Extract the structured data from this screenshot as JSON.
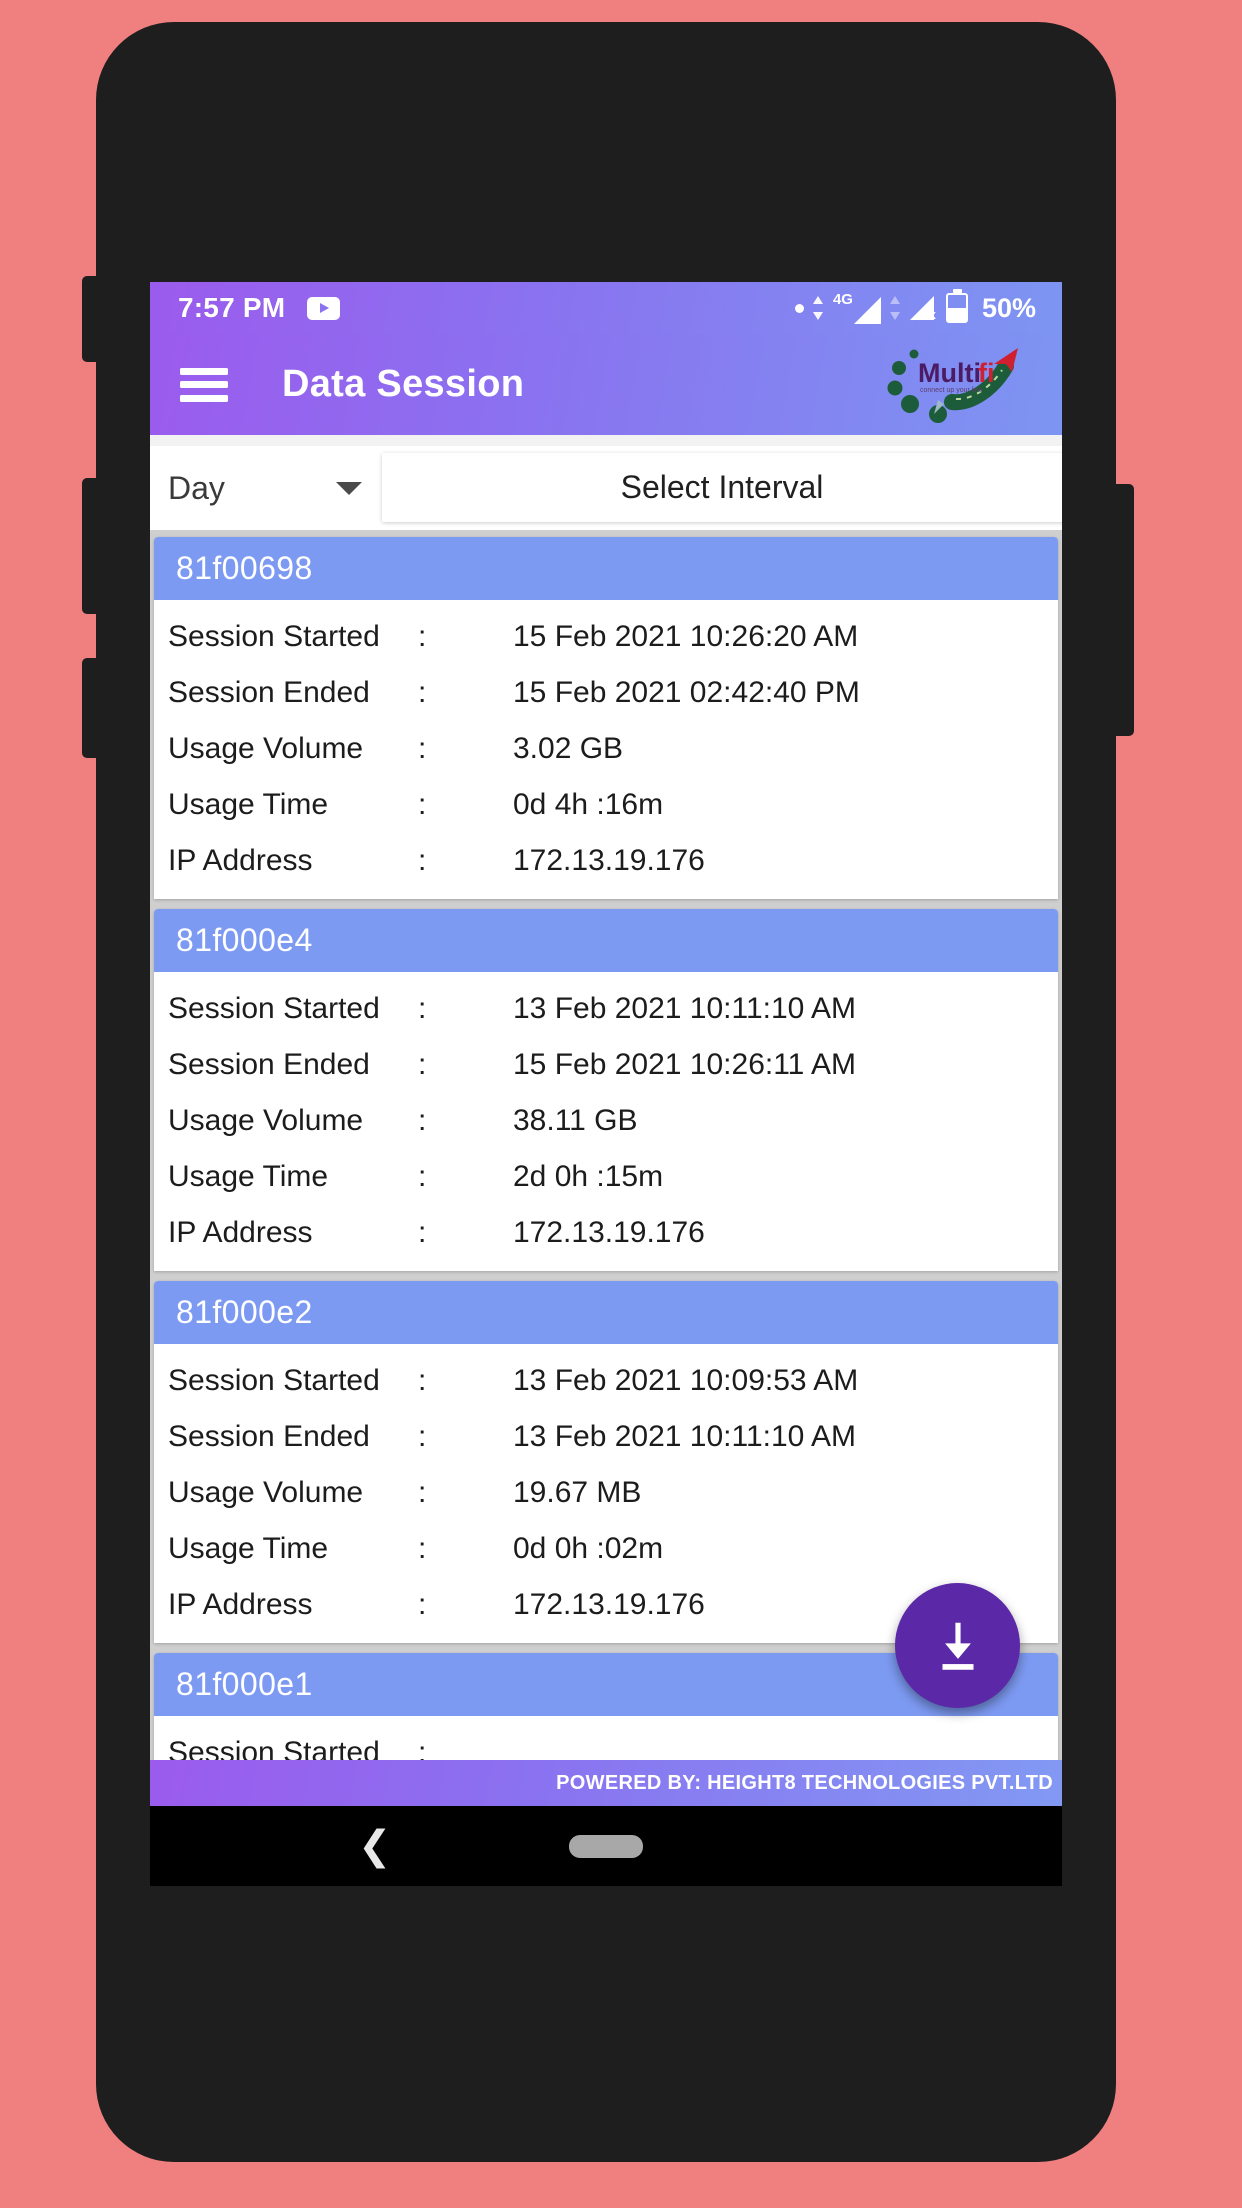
{
  "statusbar": {
    "time": "7:57 PM",
    "app_icon": "youtube-icon",
    "network_label": "4G",
    "battery_percent": "50%"
  },
  "appbar": {
    "menu_icon": "hamburger-menu-icon",
    "title": "Data Session",
    "logo_primary": "Multi",
    "logo_accent": "fi",
    "logo_tagline": "connect up your line"
  },
  "filter": {
    "period_value": "Day",
    "period_caret": "chevron-down-icon",
    "interval_button": "Select Interval"
  },
  "labels": {
    "session_started": "Session Started",
    "session_ended": "Session Ended",
    "usage_volume": "Usage Volume",
    "usage_time": "Usage Time",
    "ip_address": "IP Address",
    "separator": ":"
  },
  "sessions": [
    {
      "id": "81f00698",
      "session_started": "15 Feb 2021 10:26:20 AM",
      "session_ended": "15 Feb 2021 02:42:40 PM",
      "usage_volume": "3.02 GB",
      "usage_time": "0d 4h :16m",
      "ip_address": "172.13.19.176"
    },
    {
      "id": "81f000e4",
      "session_started": "13 Feb 2021 10:11:10 AM",
      "session_ended": "15 Feb 2021 10:26:11 AM",
      "usage_volume": "38.11 GB",
      "usage_time": "2d 0h :15m",
      "ip_address": "172.13.19.176"
    },
    {
      "id": "81f000e2",
      "session_started": "13 Feb 2021 10:09:53 AM",
      "session_ended": "13 Feb 2021 10:11:10 AM",
      "usage_volume": "19.67 MB",
      "usage_time": "0d 0h :02m",
      "ip_address": "172.13.19.176"
    },
    {
      "id": "81f000e1",
      "session_started": "",
      "session_ended": "",
      "usage_volume": "",
      "usage_time": "",
      "ip_address": ""
    }
  ],
  "fab": {
    "icon": "download-icon"
  },
  "footer": {
    "text": "POWERED BY: HEIGHT8 TECHNOLOGIES PVT.LTD"
  },
  "navbar": {
    "back_icon": "back-chevron-icon",
    "home_icon": "home-pill-icon"
  },
  "colors": {
    "page_background": "#f08080",
    "phone_body": "#1e1e1e",
    "appbar_start": "#9b5bed",
    "appbar_end": "#7d95f2",
    "card_header": "#7d9af2",
    "fab": "#5b28a8",
    "list_background": "#cfcfcf"
  }
}
